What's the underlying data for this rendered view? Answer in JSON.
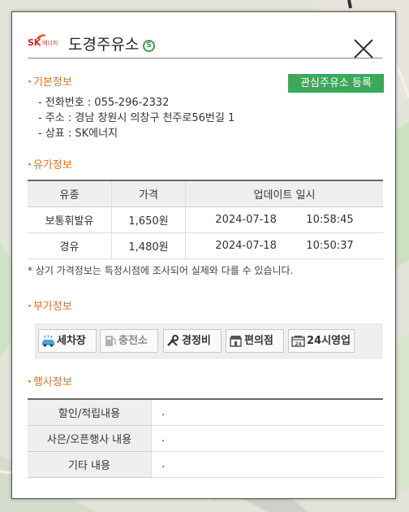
{
  "station": {
    "brand_logo_text": "SK에너지",
    "brand_logo_mark": "SK",
    "name": "도경주유소",
    "self_badge": "S",
    "close_label": "close"
  },
  "basic_info": {
    "title": "기본정보",
    "favorite_button": "관심주유소 등록",
    "phone": "- 전화번호 : 055-296-2332",
    "address": "- 주소 : 경남 창원시 의창구 천주로56번길 1",
    "brand": "- 상표 : SK에너지"
  },
  "price_info": {
    "title": "유가정보",
    "headers": [
      "유종",
      "가격",
      "업데이트 일시"
    ],
    "rows": [
      {
        "fuel": "보통휘발유",
        "price": "1,650원",
        "date": "2024-07-18",
        "time": "10:58:45"
      },
      {
        "fuel": "경유",
        "price": "1,480원",
        "date": "2024-07-18",
        "time": "10:50:37"
      }
    ],
    "notice": "* 상기 가격정보는 특정시점에 조사되어 실제와 다를 수 있습니다."
  },
  "extra_info": {
    "title": "부가정보",
    "services": [
      {
        "label": "세차장",
        "icon": "car-wash-icon",
        "available": true
      },
      {
        "label": "충전소",
        "icon": "charging-icon",
        "available": false
      },
      {
        "label": "경정비",
        "icon": "wrench-icon",
        "available": true
      },
      {
        "label": "편의점",
        "icon": "store-icon",
        "available": true
      },
      {
        "label": "24시영업",
        "icon": "24h-icon",
        "available": true
      }
    ]
  },
  "event_info": {
    "title": "행사정보",
    "rows": [
      {
        "label": "할인/적립내용",
        "value": "."
      },
      {
        "label": "사은/오픈행사 내용",
        "value": "."
      },
      {
        "label": "기타 내용",
        "value": "."
      }
    ]
  },
  "colors": {
    "accent": "#e0701f",
    "brand_red": "#e2231a",
    "button_green": "#3da75a",
    "self_green": "#3a9b46"
  }
}
